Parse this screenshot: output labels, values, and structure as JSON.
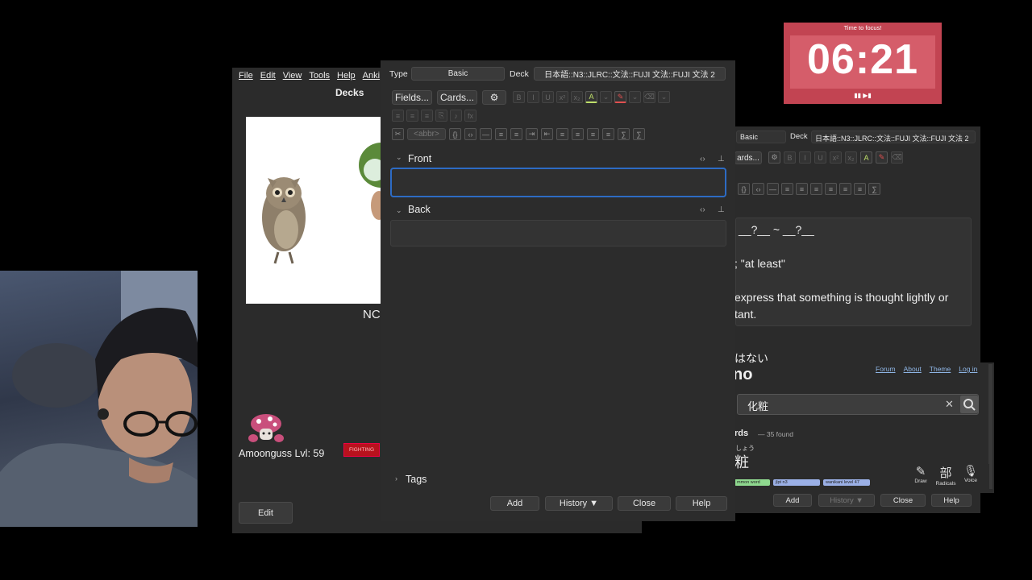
{
  "deck_window": {
    "menu": [
      "File",
      "Edit",
      "View",
      "Tools",
      "Help",
      "Anki"
    ],
    "title": "Decks",
    "card_text": "NC",
    "pet_label": "Amoonguss Lvl: 59",
    "badge": "FIGHTING",
    "edit_button": "Edit"
  },
  "add_window": {
    "type_label": "Type",
    "type_value": "Basic",
    "deck_label": "Deck",
    "deck_value": "日本語::N3::JLRC::文法::FUJI 文法::FUJI 文法 2",
    "fields_button": "Fields...",
    "cards_button": "Cards...",
    "abbr_button": "<abbr>",
    "front_label": "Front",
    "back_label": "Back",
    "tags_label": "Tags",
    "buttons": {
      "add": "Add",
      "history": "History ▼",
      "close": "Close",
      "help": "Help"
    }
  },
  "timer": {
    "caption": "Time to focus!",
    "time": "06:21",
    "controls": "▮▮ ▶▮"
  },
  "right_editor": {
    "type_value": "Basic",
    "deck_label": "Deck",
    "deck_value": "日本語::N3::JLRC::文法::FUJI 文法::FUJI 文法 2",
    "cards_button": "ards...",
    "line1": "__?__ ~ __?__",
    "line2": "; \"at least\"",
    "line3": "express that something is thought lightly or",
    "line4": "tant.",
    "line5": "はない",
    "buttons": {
      "add": "Add",
      "history": "History ▼",
      "close": "Close",
      "help": "Help"
    }
  },
  "jisho": {
    "logo": "no",
    "links": [
      "Forum",
      "About",
      "Theme",
      "Log in"
    ],
    "query": "化粧",
    "words_heading": "rds",
    "found": "— 35 found",
    "furigana": "しょう",
    "word": "粧",
    "tags": [
      "mmon word",
      "jlpt n3",
      "wanikani level 47"
    ],
    "tools": [
      "Draw",
      "Radicals",
      "Voice"
    ],
    "radicals_glyph": "部"
  },
  "colors": {
    "focus_blue": "#2d6bc4",
    "timer_red": "#c24452",
    "badge_red": "#b8121d"
  }
}
